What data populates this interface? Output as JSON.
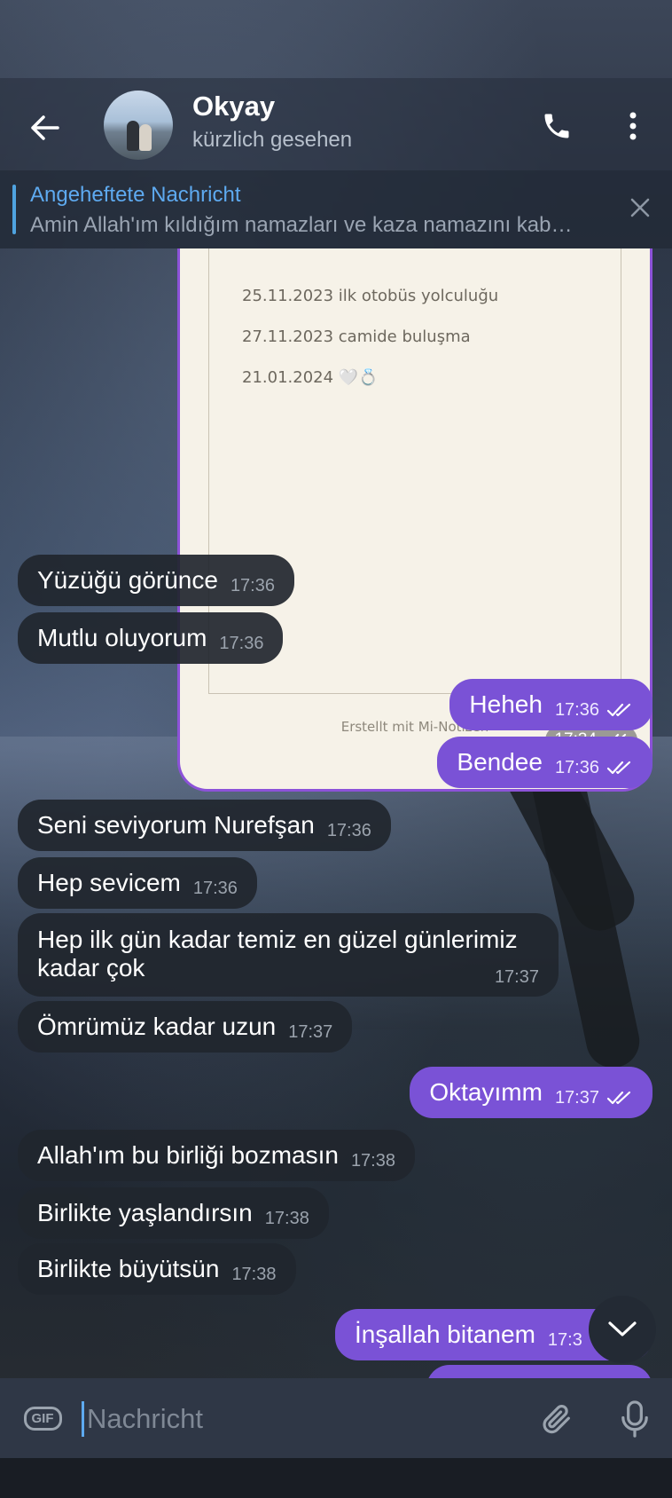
{
  "header": {
    "contact_name": "Okyay",
    "status": "kürzlich gesehen"
  },
  "icons": {
    "back": "arrow-left-icon",
    "call": "phone-icon",
    "menu": "more-vertical-icon",
    "close": "close-icon",
    "gif": "gif-icon",
    "attach": "paperclip-icon",
    "mic": "microphone-icon",
    "scroll_down": "chevron-down-icon"
  },
  "pinned": {
    "title": "Angeheftete Nachricht",
    "text": "Amin Allah'ım kıldığım namazları ve kaza namazını kab…"
  },
  "note": {
    "lines": [
      "25.11.2023 ilk otobüs yolculuğu",
      "27.11.2023 camide buluşma",
      "21.01.2024 🤍💍"
    ],
    "footer": "Erstellt mit Mi-Notizen",
    "time": "17:34"
  },
  "messages": [
    {
      "dir": "in",
      "text": "Yüzüğü görünce",
      "time": "17:36"
    },
    {
      "dir": "in",
      "text": "Mutlu oluyorum",
      "time": "17:36"
    },
    {
      "dir": "out",
      "text": "Heheh",
      "time": "17:36"
    },
    {
      "dir": "out",
      "text": "Bendee",
      "time": "17:36"
    },
    {
      "dir": "in",
      "text": "Seni seviyorum Nurefşan",
      "time": "17:36"
    },
    {
      "dir": "in",
      "text": "Hep sevicem",
      "time": "17:36"
    },
    {
      "dir": "in",
      "text": "Hep ilk gün kadar temiz en güzel günlerimiz kadar çok",
      "time": "17:37"
    },
    {
      "dir": "in",
      "text": "Ömrümüz kadar uzun",
      "time": "17:37"
    },
    {
      "dir": "out",
      "text": "Oktayımm",
      "time": "17:37"
    },
    {
      "dir": "in",
      "text": "Allah'ım bu birliği bozmasın",
      "time": "17:38"
    },
    {
      "dir": "in",
      "text": "Birlikte yaşlandırsın",
      "time": "17:38"
    },
    {
      "dir": "in",
      "text": "Birlikte büyütsün",
      "time": "17:38"
    },
    {
      "dir": "out",
      "text": "İnşallah bitanem",
      "time": "17:3"
    }
  ],
  "composer": {
    "placeholder": "Nachricht",
    "gif_label": "GIF"
  },
  "colors": {
    "outgoing_bubble": "#7a52d6",
    "incoming_bubble": "#21262e",
    "accent": "#5eaaf0"
  }
}
